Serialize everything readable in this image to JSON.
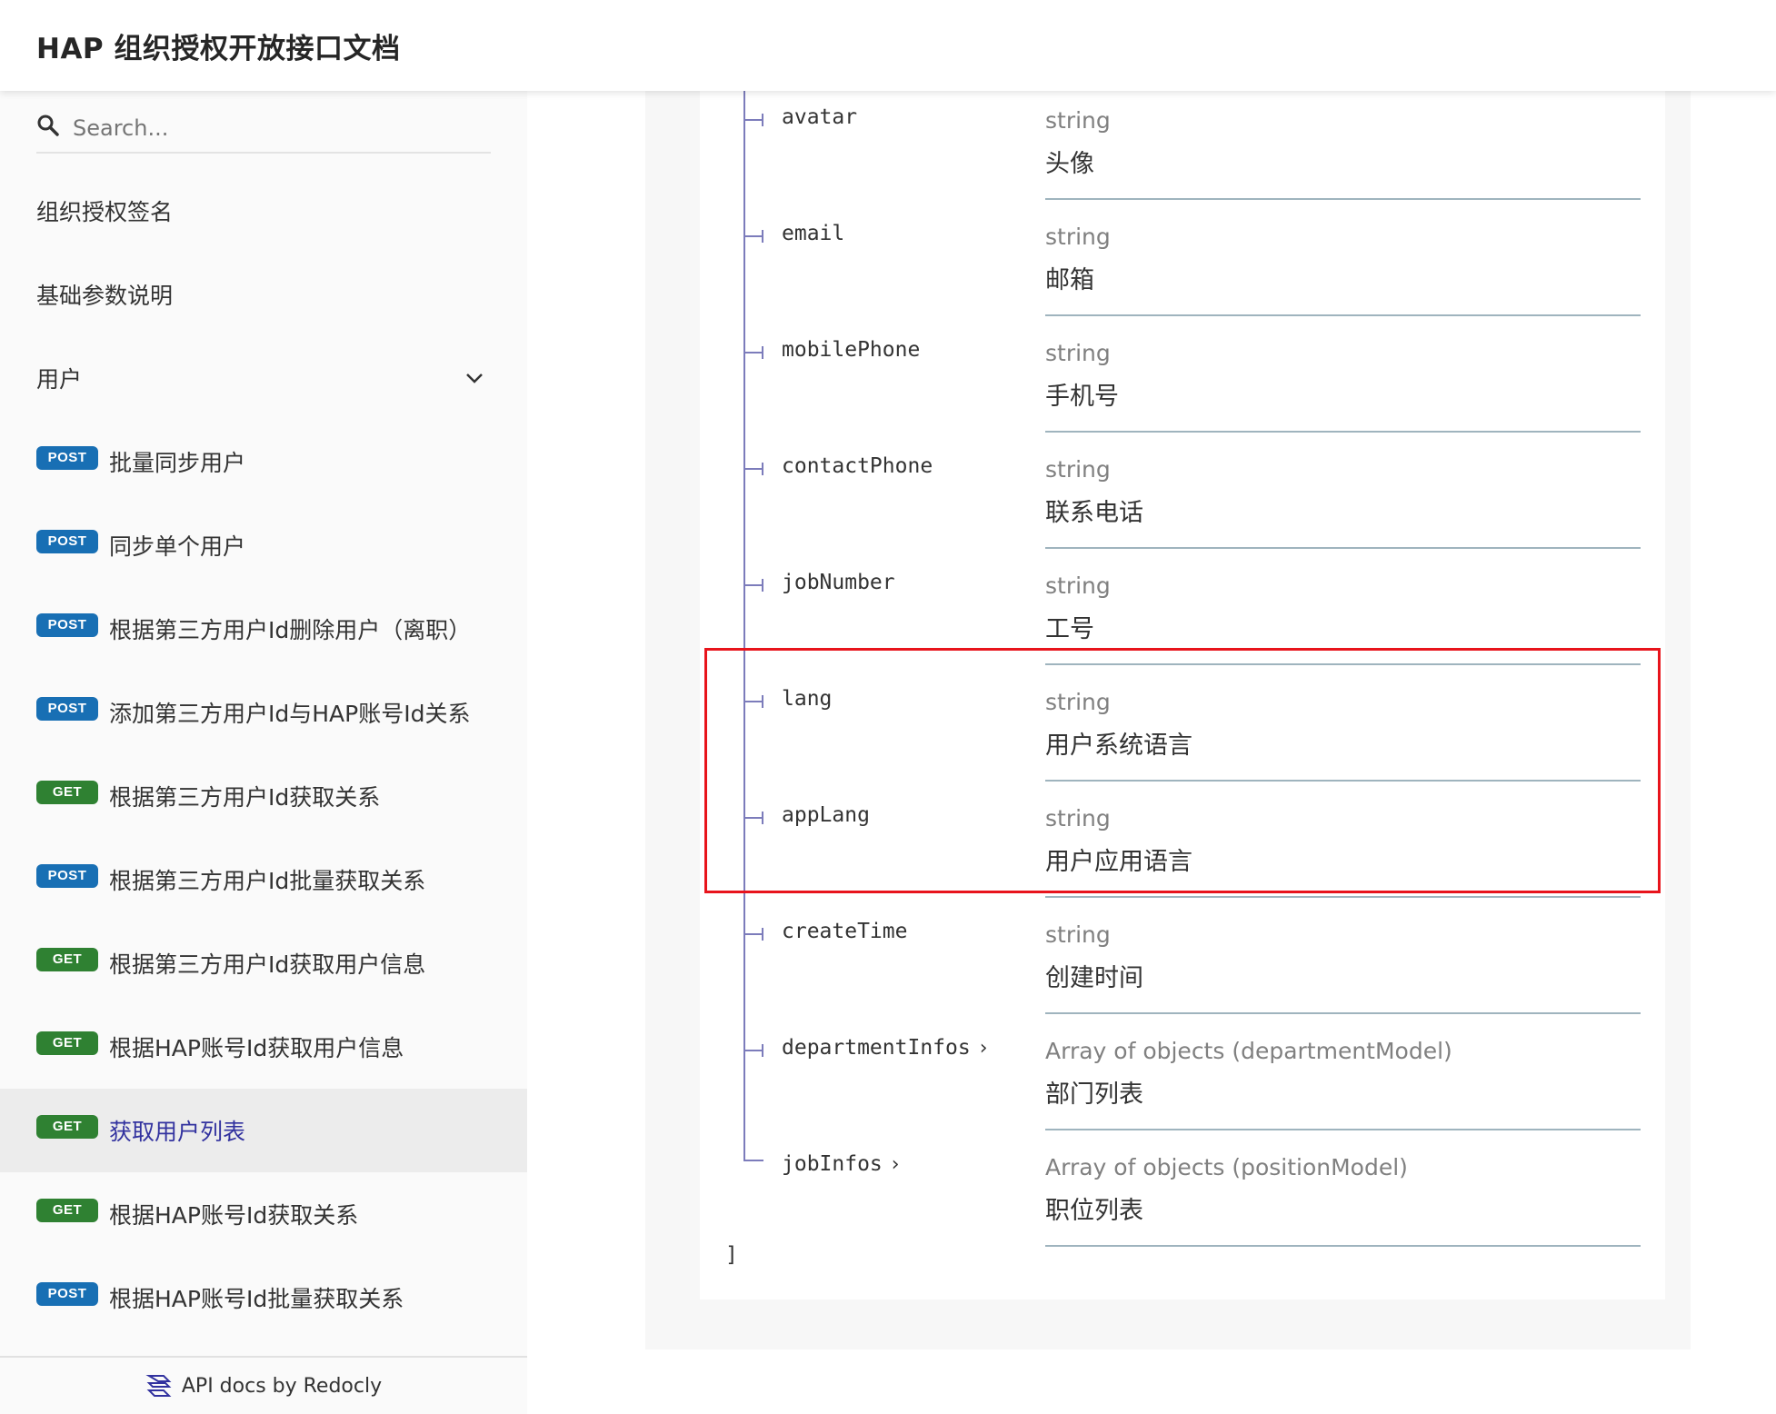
{
  "header": {
    "title": "HAP 组织授权开放接口文档"
  },
  "search": {
    "placeholder": "Search..."
  },
  "sidebar": {
    "items": [
      {
        "label": "组织授权签名",
        "method": ""
      },
      {
        "label": "基础参数说明",
        "method": ""
      },
      {
        "label": "用户",
        "method": "",
        "expandable": true
      },
      {
        "label": "批量同步用户",
        "method": "POST"
      },
      {
        "label": "同步单个用户",
        "method": "POST"
      },
      {
        "label": "根据第三方用户Id删除用户（离职）",
        "method": "POST"
      },
      {
        "label": "添加第三方用户Id与HAP账号Id关系",
        "method": "POST"
      },
      {
        "label": "根据第三方用户Id获取关系",
        "method": "GET"
      },
      {
        "label": "根据第三方用户Id批量获取关系",
        "method": "POST"
      },
      {
        "label": "根据第三方用户Id获取用户信息",
        "method": "GET"
      },
      {
        "label": "根据HAP账号Id获取用户信息",
        "method": "GET"
      },
      {
        "label": "获取用户列表",
        "method": "GET",
        "active": true
      },
      {
        "label": "根据HAP账号Id获取关系",
        "method": "GET"
      },
      {
        "label": "根据HAP账号Id批量获取关系",
        "method": "POST"
      }
    ]
  },
  "footer": {
    "label": "API docs by Redocly"
  },
  "schema": {
    "properties": [
      {
        "name": "avatar",
        "type": "string",
        "description": "头像"
      },
      {
        "name": "email",
        "type": "string",
        "description": "邮箱"
      },
      {
        "name": "mobilePhone",
        "type": "string",
        "description": "手机号"
      },
      {
        "name": "contactPhone",
        "type": "string",
        "description": "联系电话"
      },
      {
        "name": "jobNumber",
        "type": "string",
        "description": "工号"
      },
      {
        "name": "lang",
        "type": "string",
        "description": "用户系统语言"
      },
      {
        "name": "appLang",
        "type": "string",
        "description": "用户应用语言"
      },
      {
        "name": "createTime",
        "type": "string",
        "description": "创建时间"
      },
      {
        "name": "departmentInfos",
        "type": "Array of objects (departmentModel)",
        "description": "部门列表",
        "expandable": true
      },
      {
        "name": "jobInfos",
        "type": "Array of objects (positionModel)",
        "description": "职位列表",
        "expandable": true
      }
    ],
    "closing": "]"
  },
  "colors": {
    "post_badge": "#186fb4",
    "get_badge": "#2f8132",
    "active_link": "#32329f",
    "highlight": "#e8141c",
    "tree_line": "#7c7cbb"
  }
}
